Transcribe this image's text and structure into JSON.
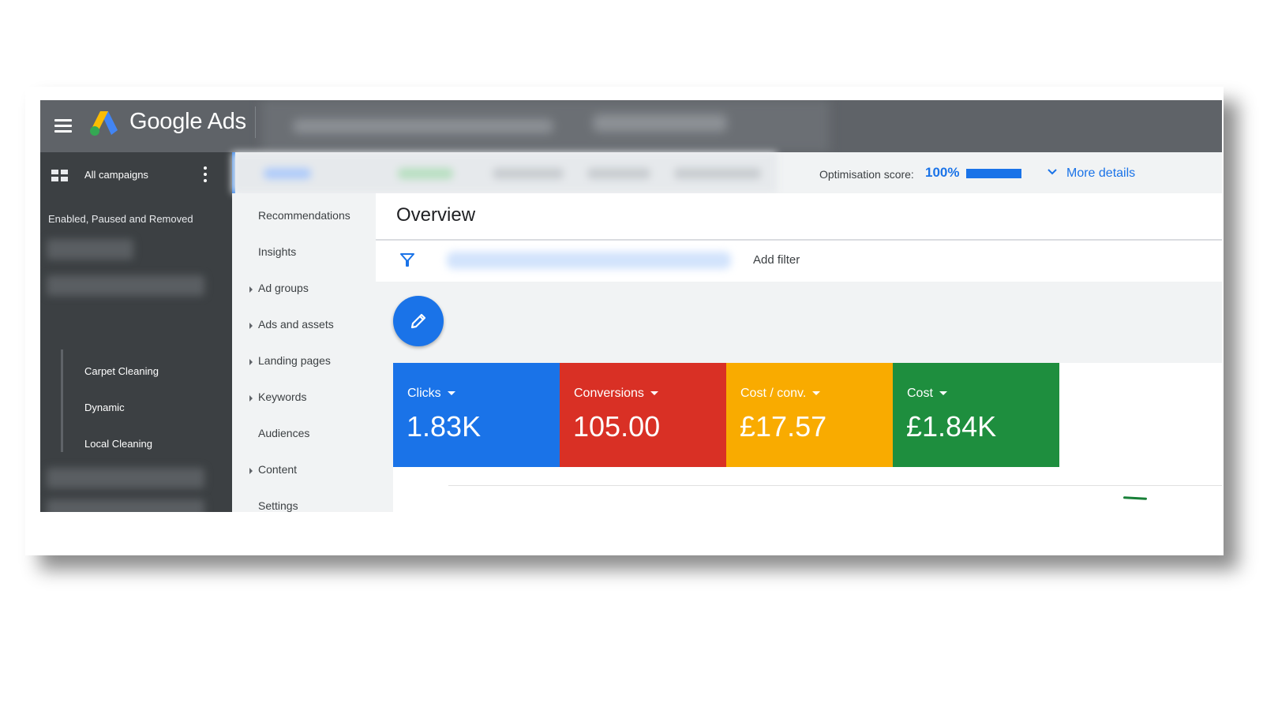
{
  "header": {
    "brand": "Google Ads"
  },
  "sidebar": {
    "title": "All campaigns",
    "status_filter": "Enabled, Paused and Removed",
    "campaigns": [
      "Carpet Cleaning",
      "Dynamic",
      "Local Cleaning"
    ]
  },
  "subbar": {
    "optimisation_label": "Optimisation score:",
    "optimisation_value": "100%",
    "optimisation_fraction": 1.0,
    "more_details": "More details"
  },
  "nav": {
    "items": [
      {
        "label": "Recommendations",
        "expandable": false
      },
      {
        "label": "Insights",
        "expandable": false
      },
      {
        "label": "Ad groups",
        "expandable": true
      },
      {
        "label": "Ads and assets",
        "expandable": true
      },
      {
        "label": "Landing pages",
        "expandable": true
      },
      {
        "label": "Keywords",
        "expandable": true
      },
      {
        "label": "Audiences",
        "expandable": false
      },
      {
        "label": "Content",
        "expandable": true
      },
      {
        "label": "Settings",
        "expandable": false
      }
    ]
  },
  "main": {
    "title": "Overview",
    "add_filter": "Add filter"
  },
  "metrics": [
    {
      "label": "Clicks",
      "value": "1.83K",
      "color": "#1a73e8"
    },
    {
      "label": "Conversions",
      "value": "105.00",
      "color": "#d93025"
    },
    {
      "label": "Cost / conv.",
      "value": "£17.57",
      "color": "#f9ab00"
    },
    {
      "label": "Cost",
      "value": "£1.84K",
      "color": "#1e8e3e"
    }
  ],
  "icons": {
    "menu": "menu-icon",
    "logo": "google-ads-logo",
    "grid": "grid-icon",
    "kebab": "more-vert-icon",
    "chevron": "chevron-down-icon",
    "filter": "filter-icon",
    "edit": "pencil-icon",
    "caret": "dropdown-caret-icon"
  }
}
